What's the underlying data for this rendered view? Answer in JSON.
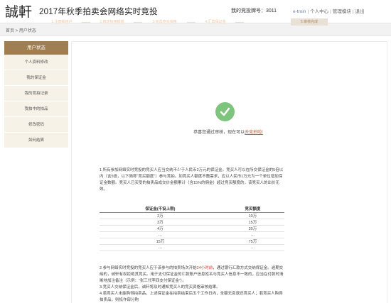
{
  "header": {
    "logo_text": "誠軒",
    "title": "2017年秋季拍卖会网络实时竞投",
    "bidder_number": "我的竞投牌号：3011",
    "user_links": [
      "e-troin",
      "个人中心",
      "管理模块",
      "退出"
    ]
  },
  "breadcrumb": "首页 > 用户状态",
  "sidebar": {
    "title": "用户状态",
    "items": [
      "个人资料修改",
      "我的保证金",
      "我的竞拍记录",
      "我拍中的拍品",
      "修改密码",
      "如何结算"
    ]
  },
  "steps": [
    "1.注册新用户",
    "2.绑定信用额度",
    "3.完善竞买资格",
    "4.汇款保证金",
    "5.审核完成"
  ],
  "active_step": 4,
  "success": {
    "text": "恭喜您通过审核，现在可以",
    "link": "去竞拍啦!"
  },
  "notice": {
    "p1": "1.所有参加网络实时竞投的竞买人应当交纳不少于人民币2万元的保证金。竞买人可以在所交保证金的5倍以内（含5倍，以下简称“竞买额度”）参与竞拍。如竞买人额度不敷需求，应以人民币1万元为一个单位增加保证金数额。竞买人已买受的拍卖品成交价金额累计（含15%的佣金）超过竞买额度的，该竞买人的出价无效。"
  },
  "deposit_table": {
    "headers": [
      "保证金(不设上限)",
      "竞买额度"
    ],
    "rows": [
      [
        "2万",
        "10万"
      ],
      [
        "3万",
        "15万"
      ],
      [
        "4万",
        "20万"
      ],
      [
        "…",
        "…"
      ],
      [
        "15万",
        "75万"
      ],
      [
        "…",
        "…"
      ]
    ]
  },
  "notes": {
    "p2_a": "2.参与网络实时竞投的竞买人应于该参与的拍卖场次开始",
    "p2_red": "24小时前",
    "p2_b": "，通过银行汇款方式交纳保证金。逾期交纳的，诚轩有权拒绝其竞买。用于支付保证金的汇款账户信息姓名与竞买人信息不一致的，应当在付款时清晰地加注备注（示例：“张三代李四支付保证金”）。",
    "p3": "3.竞买人交纳保证金后，诚轩将及时通知竞买人的竞买资格审核结果。",
    "p4": "4.若竞买人未能购得拍卖品，上述保证金在拍卖结束后五个工作日内，全额无息退还竞买人；若竞买人购得拍卖品，则抵作部分购"
  }
}
